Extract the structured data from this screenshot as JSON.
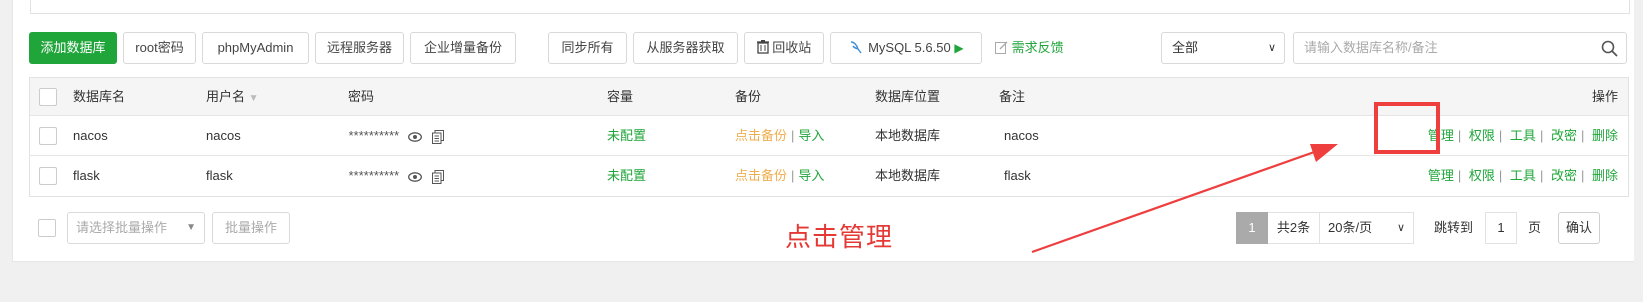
{
  "toolbar": {
    "add_db": "添加数据库",
    "root_pwd": "root密码",
    "phpmyadmin": "phpMyAdmin",
    "remote": "远程服务器",
    "backup": "企业增量备份",
    "sync_all": "同步所有",
    "fetch": "从服务器获取",
    "recycle": "回收站",
    "mysql": "MySQL 5.6.50",
    "feedback": "需求反馈",
    "filter_value": "全部",
    "search_placeholder": "请输入数据库名称/备注"
  },
  "table": {
    "headers": {
      "name": "数据库名",
      "user": "用户名",
      "password": "密码",
      "capacity": "容量",
      "backup": "备份",
      "location": "数据库位置",
      "note": "备注",
      "ops": "操作"
    },
    "rows": [
      {
        "name": "nacos",
        "user": "nacos",
        "password": "**********",
        "capacity": "未配置",
        "backup_link": "点击备份",
        "import": "导入",
        "location": "本地数据库",
        "note": "nacos",
        "ops": [
          "管理",
          "权限",
          "工具",
          "改密",
          "删除"
        ]
      },
      {
        "name": "flask",
        "user": "flask",
        "password": "**********",
        "capacity": "未配置",
        "backup_link": "点击备份",
        "import": "导入",
        "location": "本地数据库",
        "note": "flask",
        "ops": [
          "管理",
          "权限",
          "工具",
          "改密",
          "删除"
        ]
      }
    ]
  },
  "footer": {
    "batch_placeholder": "请选择批量操作",
    "batch_button": "批量操作",
    "page": "1",
    "total": "共2条",
    "per_page": "20条/页",
    "jump_label": "跳转到",
    "jump_value": "1",
    "page_unit": "页",
    "confirm": "确认"
  },
  "annotation": {
    "text": "点击管理"
  },
  "colors": {
    "accent": "#20a53a",
    "warning": "#f0ad4e",
    "annotation": "#e53935"
  }
}
